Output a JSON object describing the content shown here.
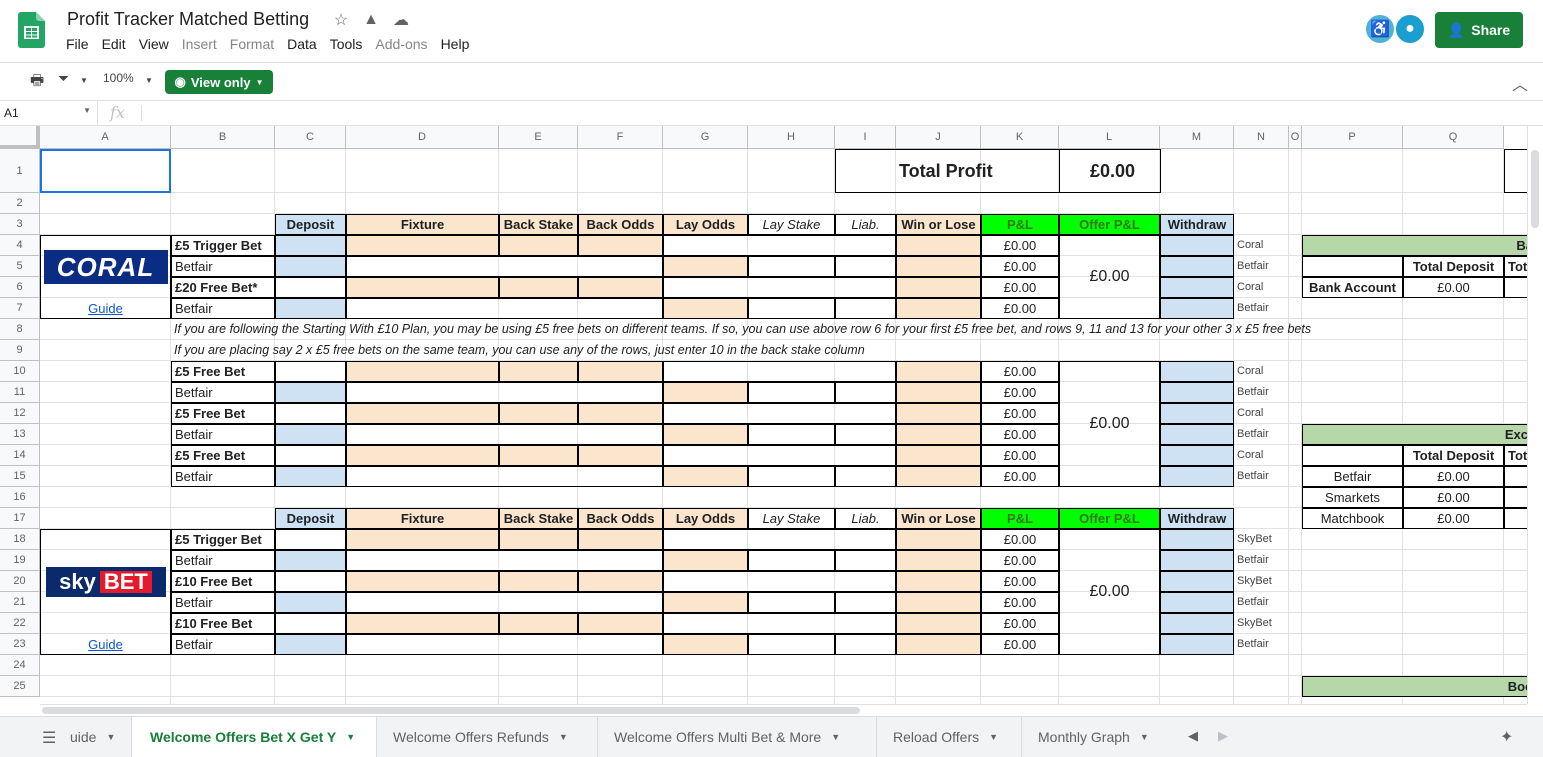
{
  "app": {
    "title": "Profit Tracker Matched Betting",
    "menus": [
      "File",
      "Edit",
      "View",
      "Insert",
      "Format",
      "Data",
      "Tools",
      "Add-ons",
      "Help"
    ],
    "menus_disabled": [
      "Insert",
      "Format",
      "Add-ons"
    ],
    "share": "Share"
  },
  "toolbar": {
    "zoom": "100%",
    "view_only": "View only"
  },
  "formula_bar": {
    "cell_ref": "A1",
    "fx": "fx"
  },
  "columns": [
    "A",
    "B",
    "C",
    "D",
    "E",
    "F",
    "G",
    "H",
    "I",
    "J",
    "K",
    "L",
    "M",
    "N",
    "O",
    "P",
    "Q"
  ],
  "rows": [
    "1",
    "2",
    "3",
    "4",
    "5",
    "6",
    "7",
    "8",
    "9",
    "10",
    "11",
    "12",
    "13",
    "14",
    "15",
    "16",
    "17",
    "18",
    "19",
    "20",
    "21",
    "22",
    "23",
    "24",
    "25"
  ],
  "summary": {
    "total_profit_label": "Total Profit",
    "total_profit_value": "£0.00"
  },
  "headers": {
    "deposit": "Deposit",
    "fixture": "Fixture",
    "back_stake": "Back Stake",
    "back_odds": "Back Odds",
    "lay_odds": "Lay Odds",
    "lay_stake": "Lay Stake",
    "liab": "Liab.",
    "win_or_lose": "Win or Lose",
    "pl": "P&L",
    "offer_pl": "Offer P&L",
    "withdraw": "Withdraw"
  },
  "coral": {
    "logo": "CORAL",
    "guide": "Guide",
    "rows": [
      "£5 Trigger Bet",
      "Betfair",
      "£20 Free Bet*",
      "Betfair"
    ],
    "offer_pl": "£0.00",
    "sites": [
      "Coral",
      "Betfair",
      "Coral",
      "Betfair"
    ]
  },
  "notes": [
    "If you are following the Starting With £10 Plan, you may be using £5 free bets on different teams. If so, you can use above row 6 for your first £5 free bet, and rows 9, 11 and 13 for your other 3 x £5 free bets",
    "If you are placing say 2 x £5 free bets on the same team, you can use any of the rows, just enter 10 in the back stake column"
  ],
  "coral_extra": {
    "rows": [
      "£5 Free Bet",
      "Betfair",
      "£5 Free Bet",
      "Betfair",
      "£5 Free Bet",
      "Betfair"
    ],
    "offer_pl": "£0.00",
    "sites": [
      "Coral",
      "Betfair",
      "Coral",
      "Betfair",
      "Coral",
      "Betfair"
    ]
  },
  "skybet": {
    "logo_sky": "sky",
    "logo_bet": "BET",
    "guide": "Guide",
    "rows": [
      "£5 Trigger Bet",
      "Betfair",
      "£10 Free Bet",
      "Betfair",
      "£10 Free Bet",
      "Betfair"
    ],
    "offer_pl": "£0.00",
    "sites": [
      "SkyBet",
      "Betfair",
      "SkyBet",
      "Betfair",
      "SkyBet",
      "Betfair"
    ]
  },
  "pl_value": "£0.00",
  "balances": {
    "title": "Balanc",
    "total_deposit": "Total Deposit",
    "tot": "Tot",
    "bank_account": "Bank Account",
    "bank_value": "£0.00"
  },
  "exchanges": {
    "title": "Exchang",
    "total_deposit": "Total Deposit",
    "tot": "Tot",
    "items": [
      {
        "name": "Betfair",
        "value": "£0.00"
      },
      {
        "name": "Smarkets",
        "value": "£0.00"
      },
      {
        "name": "Matchbook",
        "value": "£0.00"
      }
    ]
  },
  "bookmakers": {
    "title": "Bookma"
  },
  "tabs": {
    "items": [
      "uide",
      "Welcome Offers Bet X Get Y",
      "Welcome Offers Refunds",
      "Welcome Offers Multi Bet & More",
      "Reload Offers",
      "Monthly Graph"
    ],
    "active": 1
  },
  "colors": {
    "green": "#188038",
    "blue_cell": "#cfe2f3",
    "peach_cell": "#fce5cd",
    "pl_green": "#00ff00",
    "box_green": "#b6d7a8"
  }
}
